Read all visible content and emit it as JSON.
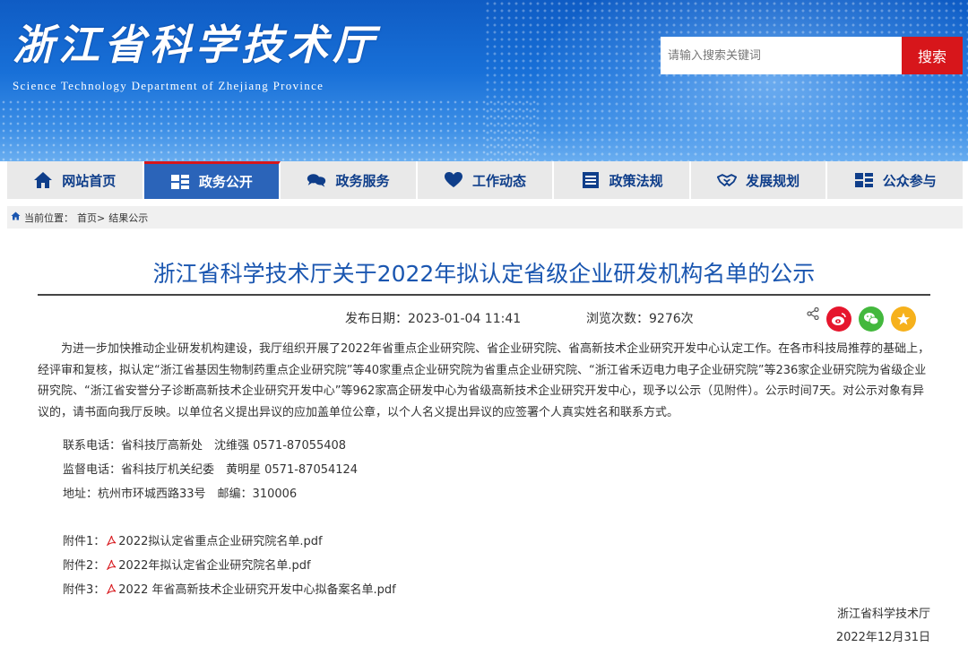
{
  "header": {
    "title": "浙江省科学技术厅",
    "subtitle": "Science Technology Department of Zhejiang Province",
    "search": {
      "placeholder": "请输入搜索关键词",
      "value": "",
      "button_label": "搜索"
    }
  },
  "nav": {
    "items": [
      {
        "label": "网站首页",
        "icon": "home-icon",
        "active": false
      },
      {
        "label": "政务公开",
        "icon": "open-government-icon",
        "active": true
      },
      {
        "label": "政务服务",
        "icon": "chat-bubbles-icon",
        "active": false
      },
      {
        "label": "工作动态",
        "icon": "heart-icon",
        "active": false
      },
      {
        "label": "政策法规",
        "icon": "document-list-icon",
        "active": false
      },
      {
        "label": "发展规划",
        "icon": "handshake-icon",
        "active": false
      },
      {
        "label": "公众参与",
        "icon": "participation-icon",
        "active": false
      }
    ],
    "accent_color": "#d7161b",
    "active_color": "#2b64b9"
  },
  "breadcrumb": {
    "icon": "home-icon",
    "prefix": "当前位置：",
    "home": "首页>",
    "current": "结果公示"
  },
  "article": {
    "title": "浙江省科学技术厅关于2022年拟认定省级企业研发机构名单的公示",
    "publish_label": "发布日期：2023-01-04 11:41",
    "views_label": "浏览次数：9276次",
    "share_icons": [
      "share-icon",
      "weibo-icon",
      "wechat-icon",
      "favorite-star-icon"
    ],
    "body_paragraph": "为进一步加快推动企业研发机构建设，我厅组织开展了2022年省重点企业研究院、省企业研究院、省高新技术企业研究开发中心认定工作。在各市科技局推荐的基础上，经评审和复核，拟认定“浙江省基因生物制药重点企业研究院”等40家重点企业研究院为省重点企业研究院、“浙江省禾迈电力电子企业研究院”等236家企业研究院为省级企业研究院、“浙江省安誉分子诊断高新技术企业研究开发中心”等962家高企研发中心为省级高新技术企业研究开发中心，现予以公示（见附件）。公示时间7天。对公示对象有异议的，请书面向我厅反映。以单位名义提出异议的应加盖单位公章，以个人名义提出异议的应签署个人真实姓名和联系方式。",
    "contacts": [
      "联系电话：省科技厅高新处　沈维强 0571-87055408",
      "监督电话：省科技厅机关纪委　黄明星 0571-87054124",
      "地址：杭州市环城西路33号　邮编：310006"
    ],
    "attachments": [
      {
        "label": "附件1：",
        "file": "2022拟认定省重点企业研究院名单.pdf"
      },
      {
        "label": "附件2：",
        "file": "2022年拟认定省企业研究院名单.pdf"
      },
      {
        "label": "附件3：",
        "file": "2022 年省高新技术企业研究开发中心拟备案名单.pdf"
      }
    ],
    "signature_org": "浙江省科学技术厅",
    "signature_date": "2022年12月31日"
  }
}
